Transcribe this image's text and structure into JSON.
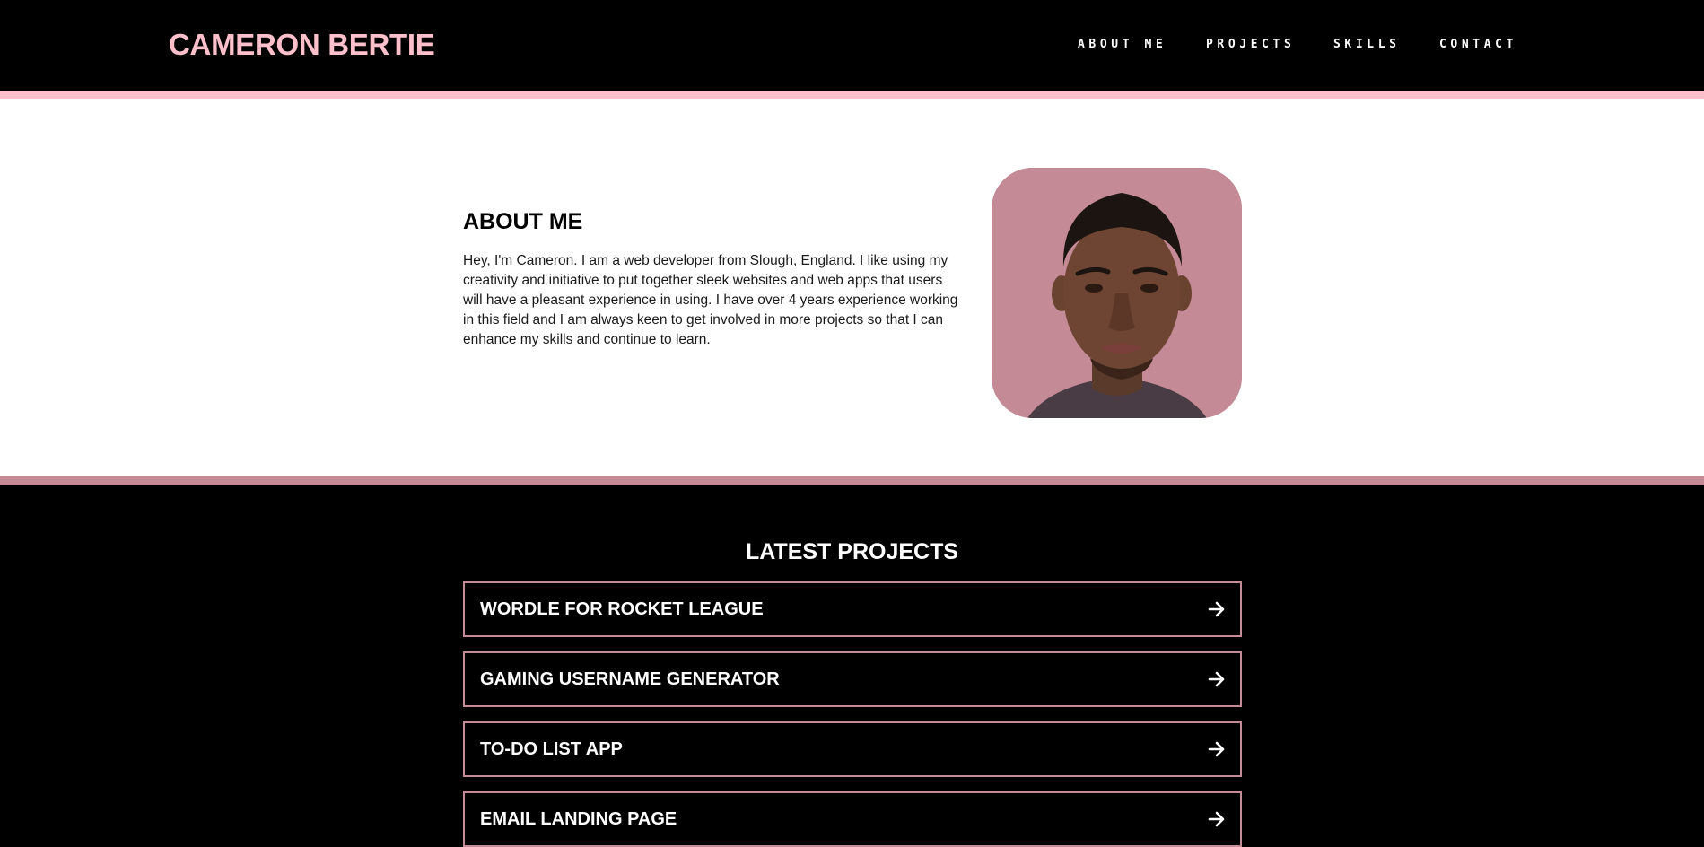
{
  "header": {
    "logo": "CAMERON BERTIE",
    "nav": [
      {
        "label": "ABOUT ME"
      },
      {
        "label": "PROJECTS"
      },
      {
        "label": "SKILLS"
      },
      {
        "label": "CONTACT"
      }
    ]
  },
  "about": {
    "title": "ABOUT ME",
    "text": "Hey, I'm Cameron. I am a web developer from Slough, England. I like using my creativity and initiative to put together sleek websites and web apps that users will have a pleasant experience in using. I have over 4 years experience working in this field and I am always keen to get involved in more projects so that I can enhance my skills and continue to learn.",
    "photo_icon": "profile-photo"
  },
  "projects": {
    "title": "LATEST PROJECTS",
    "items": [
      {
        "label": "WORDLE FOR ROCKET LEAGUE",
        "icon": "arrow-right-icon"
      },
      {
        "label": "GAMING USERNAME GENERATOR",
        "icon": "arrow-right-icon"
      },
      {
        "label": "TO-DO LIST APP",
        "icon": "arrow-right-icon"
      },
      {
        "label": "EMAIL LANDING PAGE",
        "icon": "arrow-right-icon"
      }
    ]
  },
  "colors": {
    "accent_pink": "#ffc0cb",
    "accent_mauve": "#c48a96",
    "background": "#000000",
    "about_background": "#ffffff"
  }
}
